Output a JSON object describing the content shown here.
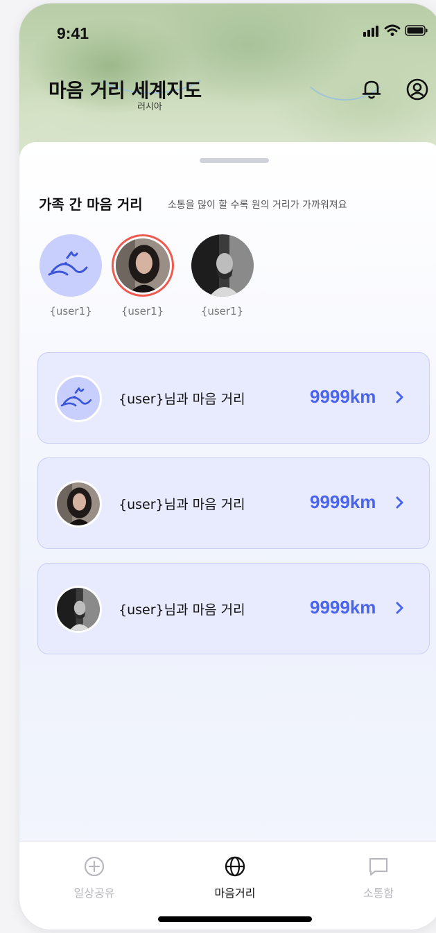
{
  "status": {
    "time": "9:41"
  },
  "header": {
    "title": "마음 거리 세계지도",
    "map_label": "러시아"
  },
  "section": {
    "title": "가족 간 마음 거리",
    "subtitle": "소통을 많이 할 수록 원의 거리가 가까워져요"
  },
  "avatars": [
    {
      "name": "{user1}",
      "type": "character-icon"
    },
    {
      "name": "{user1}",
      "type": "photo-woman",
      "selected": true
    },
    {
      "name": "{user1}",
      "type": "photo-man"
    }
  ],
  "cards": [
    {
      "label": "{user}님과 마음 거리",
      "distance": "9999km",
      "avatar": "character-icon"
    },
    {
      "label": "{user}님과 마음 거리",
      "distance": "9999km",
      "avatar": "photo-woman"
    },
    {
      "label": "{user}님과 마음 거리",
      "distance": "9999km",
      "avatar": "photo-man"
    }
  ],
  "tabs": [
    {
      "label": "일상공유",
      "icon": "plus-circle-icon",
      "active": false
    },
    {
      "label": "마음거리",
      "icon": "globe-icon",
      "active": true
    },
    {
      "label": "소통함",
      "icon": "chat-bubble-icon",
      "active": false
    }
  ],
  "colors": {
    "accent": "#4a64f0",
    "selected_ring": "#ef5a4f",
    "card_bg": "#e8ebfd",
    "tab_inactive": "#b8b8be"
  }
}
